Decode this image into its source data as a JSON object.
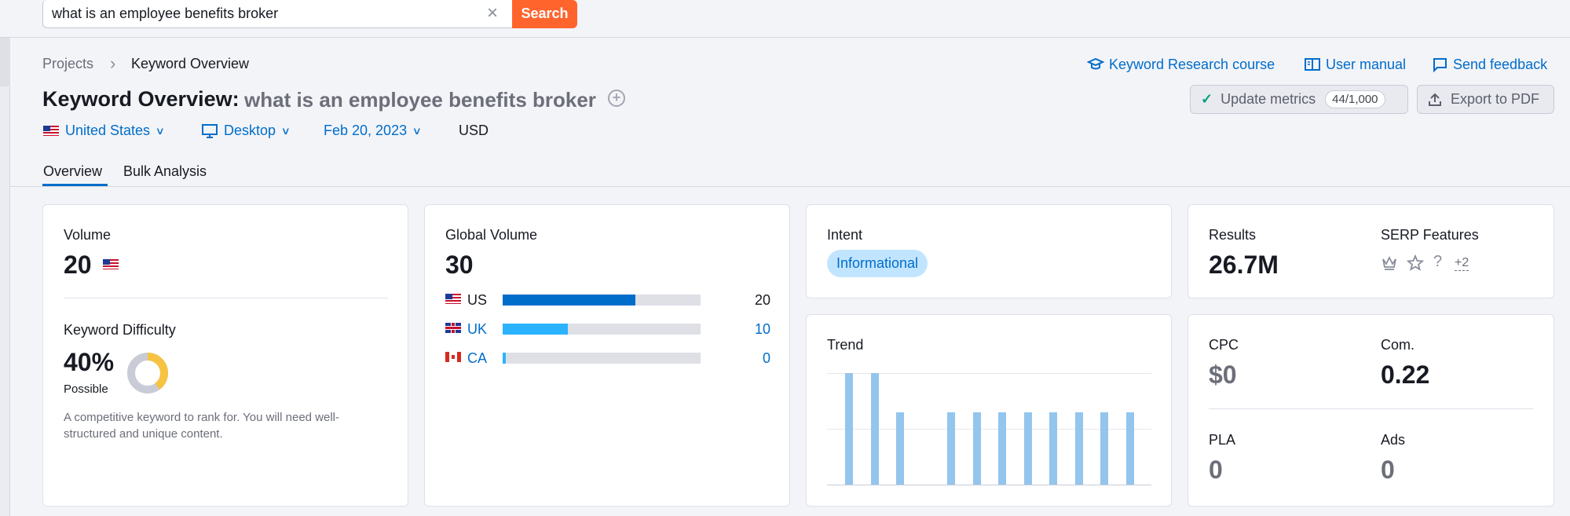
{
  "search": {
    "query": "what is an employee benefits broker",
    "button": "Search",
    "clear_icon": "close-icon"
  },
  "breadcrumb": {
    "items": [
      "Projects",
      "Keyword Overview"
    ],
    "separator": "›"
  },
  "top_links": {
    "course": "Keyword Research course",
    "manual": "User manual",
    "feedback": "Send feedback"
  },
  "header": {
    "title": "Keyword Overview:",
    "keyword": "what is an employee benefits broker",
    "update_label": "Update metrics",
    "quota": "44/1,000",
    "export_label": "Export to PDF"
  },
  "filters": {
    "country": "United States",
    "device": "Desktop",
    "date": "Feb 20, 2023",
    "currency": "USD"
  },
  "tabs": [
    {
      "label": "Overview",
      "active": true
    },
    {
      "label": "Bulk Analysis",
      "active": false
    }
  ],
  "volume": {
    "label": "Volume",
    "value": "20"
  },
  "difficulty": {
    "label": "Keyword Difficulty",
    "value": "40%",
    "level": "Possible",
    "percent": 40,
    "note": "A competitive keyword to rank for. You will need well-structured and unique content."
  },
  "global_volume": {
    "label": "Global Volume",
    "value": "30",
    "countries": [
      {
        "code": "US",
        "value": "20",
        "share": 0.67,
        "color": "#006dca"
      },
      {
        "code": "UK",
        "value": "10",
        "share": 0.33,
        "color": "#2bb3ff"
      },
      {
        "code": "CA",
        "value": "0",
        "share": 0.015,
        "color": "#2bb3ff"
      }
    ]
  },
  "intent": {
    "label": "Intent",
    "value": "Informational"
  },
  "results": {
    "label": "Results",
    "value": "26.7M"
  },
  "serp": {
    "label": "SERP Features",
    "more": "+2",
    "icons": [
      "crown-icon",
      "star-icon",
      "question-icon"
    ]
  },
  "trend": {
    "label": "Trend",
    "values": [
      1.0,
      1.0,
      0.65,
      0,
      0.65,
      0.65,
      0.65,
      0.65,
      0.65,
      0.65,
      0.65,
      0.65
    ]
  },
  "cpc": {
    "label": "CPC",
    "value": "$0"
  },
  "com": {
    "label": "Com.",
    "value": "0.22"
  },
  "pla": {
    "label": "PLA",
    "value": "0"
  },
  "ads": {
    "label": "Ads",
    "value": "0"
  },
  "colors": {
    "accent": "#006dca",
    "search_button": "#ff642d",
    "trend_bar": "#93c5ed",
    "difficulty_fill": "#f6c342"
  }
}
